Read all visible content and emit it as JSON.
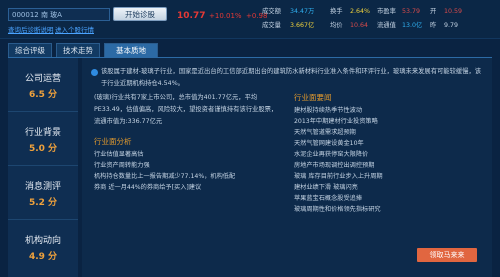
{
  "header": {
    "stock_input": "000012 南 玻A",
    "hint_links": [
      "查询后诊断说明",
      "进入个股行情"
    ],
    "diag_button": "开始诊股",
    "price": "10.77",
    "change_pct": "+10.01%",
    "change_abs": "+0.98",
    "quotes": [
      {
        "label": "成交额",
        "value": "34.47万",
        "color": "#2fb0f0"
      },
      {
        "label": "换手",
        "value": "2.64%",
        "color": "#f0d23c"
      },
      {
        "label": "市盈率",
        "value": "53.79",
        "color": "#d94b4b"
      },
      {
        "label": "开",
        "value": "10.59",
        "color": "#d94b4b"
      },
      {
        "label": "成交量",
        "value": "3.667亿",
        "color": "#f0d23c"
      },
      {
        "label": "均价",
        "value": "10.64",
        "color": "#d94b4b"
      },
      {
        "label": "流通值",
        "value": "13.0亿",
        "color": "#2fb0f0"
      },
      {
        "label": "昨",
        "value": "9.79",
        "color": "#c6d5e5"
      }
    ],
    "colors": {
      "price_up": "#e53935"
    }
  },
  "tabs": [
    "综合评级",
    "技术走势",
    "基本质地"
  ],
  "active_tab": 2,
  "sidebar": [
    {
      "label": "公司运营",
      "score": "6.5 分"
    },
    {
      "label": "行业背景",
      "score": "5.0 分"
    },
    {
      "label": "消息测评",
      "score": "5.2 分"
    },
    {
      "label": "机构动向",
      "score": "4.9 分"
    }
  ],
  "main": {
    "summary": "该股属于建材-玻璃子行业，国家是近出台的工信部近期出台的建筑防水新材料行业准入条件和环评行业，玻璃未来发展有可能较缓慢，该于行业近期机构持仓4.54%。",
    "company_para": "(玻璃)行业共有7家上市公司，总市值为401.77亿元，平均PE33.49，估值偏高，风险较大，望投资者谨慎持有该行业股票，流通市值为:336.77亿元",
    "industry_analysis": {
      "title": "行业面分析",
      "items": [
        "行业估值显著高估",
        "行业资产周转能力强",
        "机构持仓数量比上一报告期减少77.14%，机构低配",
        "券商 近一月44%的券商给予[买入]建议"
      ]
    },
    "industry_news": {
      "title": "行业面要闻",
      "items": [
        "建材股持续热季节性波动",
        "2013年中期建材行业投资策略",
        "天然气管道需求超预期",
        "天然气管网建设黄金10年",
        "水泥企业再获停窑大限降价",
        "房地产市场现调控出调控预期",
        "玻璃 库存目前行业步入上升周期",
        "建材业绩下滑 玻璃闪亮",
        "苹果蓝宝石概念股受追捧",
        "玻璃周期性和价格领先指标研究"
      ]
    },
    "cta_label": "领取马来来"
  }
}
